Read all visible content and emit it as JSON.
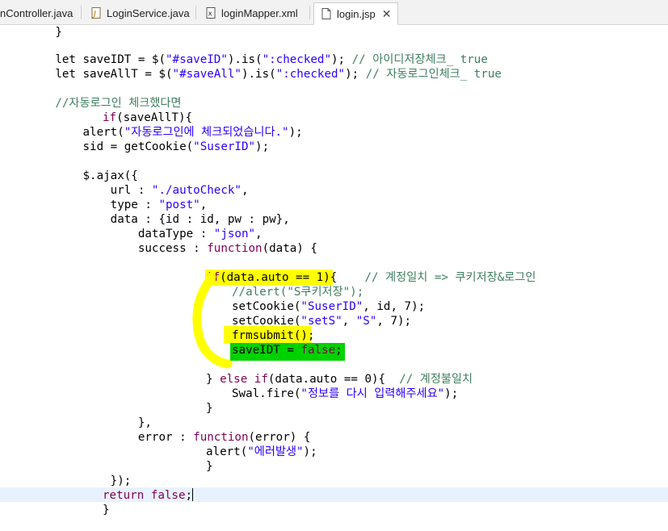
{
  "tabs": [
    {
      "label": "nController.java",
      "icon": "java-file-icon",
      "active": false
    },
    {
      "label": "LoginService.java",
      "icon": "java-file-icon",
      "active": false
    },
    {
      "label": "loginMapper.xml",
      "icon": "xml-file-icon",
      "active": false
    },
    {
      "label": "login.jsp",
      "icon": "jsp-file-icon",
      "active": true,
      "close": "✕"
    }
  ],
  "code": {
    "l1": "        }",
    "l3a": "        let saveIDT = $(",
    "l3b": "\"#saveID\"",
    "l3c": ").is(",
    "l3d": "\":checked\"",
    "l3e": "); ",
    "l3f": "// 아이디저장체크_ true",
    "l4a": "        let saveAllT = $(",
    "l4b": "\"#saveAll\"",
    "l4c": ").is(",
    "l4d": "\":checked\"",
    "l4e": "); ",
    "l4f": "// 자동로그인체크_ true",
    "l6": "        //자동로그인 체크했다면",
    "l7a": "if",
    "l7b": "(saveAllT){",
    "l8a": "            alert(",
    "l8b": "\"자동로그인에 체크되었습니다.\"",
    "l8c": ");",
    "l9a": "            sid = getCookie(",
    "l9b": "\"SuserID\"",
    "l9c": ");",
    "l11": "            $.ajax({",
    "l12a": "                url : ",
    "l12b": "\"./autoCheck\"",
    "l12c": ",",
    "l13a": "                type : ",
    "l13b": "\"post\"",
    "l13c": ",",
    "l14": "                data : {id : id, pw : pw},",
    "l15a": "                    dataType : ",
    "l15b": "\"json\"",
    "l15c": ",",
    "l16a": "                    success : ",
    "l16b": "function",
    "l16c": "(data) {",
    "l18a": "if",
    "l18b": "(data.auto == 1){",
    "l18c": "    // 계정일치 => 쿠키저장&로그인",
    "l19": "//alert(\"S쿠키저장\");",
    "l20a": "setCookie(",
    "l20b": "\"SuserID\"",
    "l20c": ", id, 7);",
    "l21a": "setCookie(",
    "l21b": "\"setS\"",
    "l21c": ", ",
    "l21d": "\"S\"",
    "l21e": ", 7);",
    "l22": "frmsubmit();",
    "l23a": "saveIDT = ",
    "l23b": "false",
    "l23c": ";",
    "l25a": "} ",
    "l25b": "else if",
    "l25c": "(data.auto == 0){  ",
    "l25d": "// 계정불일치",
    "l26a": "Swal.fire(",
    "l26b": "\"정보를 다시 입력해주세요\"",
    "l26c": ");",
    "l27": "}",
    "l28": "                    },",
    "l29a": "                    error : ",
    "l29b": "function",
    "l29c": "(error) {",
    "l30a": "alert(",
    "l30b": "\"에러발생\"",
    "l30c": ");",
    "l31": "}",
    "l32": "                });",
    "l33a": "return false",
    "l33b": ";",
    "l34": "}"
  },
  "colors": {
    "string": "#2a00ff",
    "comment": "#3f7f5f",
    "keyword": "#7f0055",
    "highlight_yellow": "#ffff00",
    "highlight_green": "#00d200",
    "current_line": "#e8f2fe"
  }
}
